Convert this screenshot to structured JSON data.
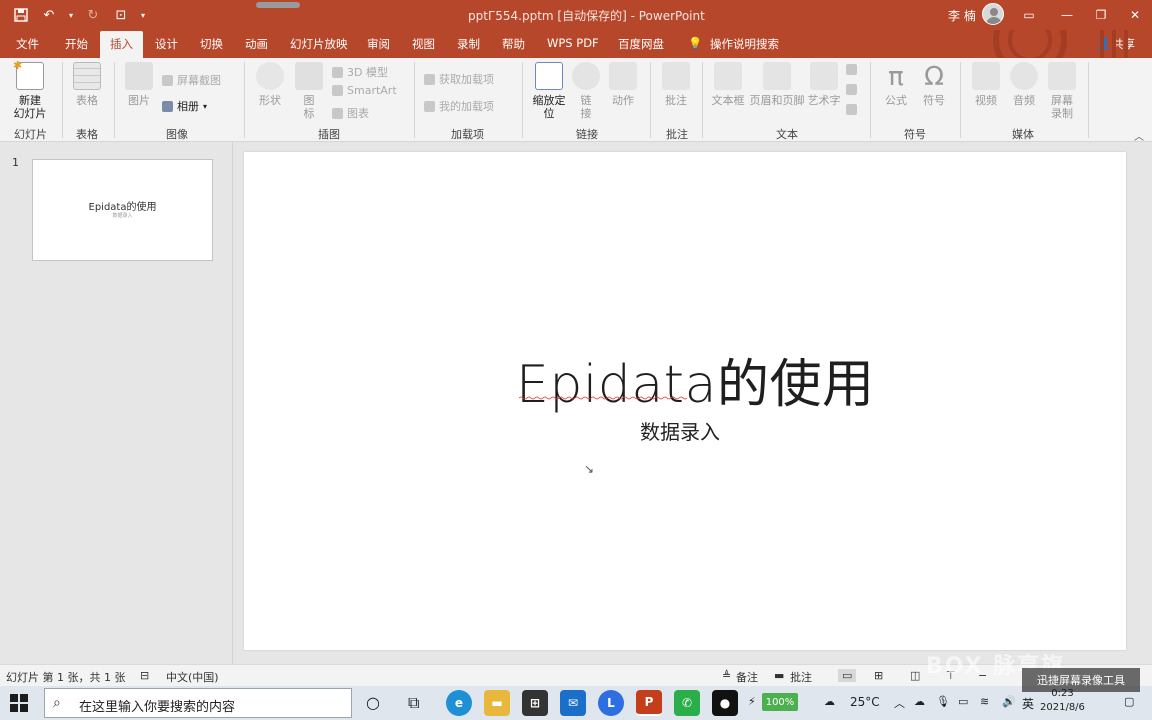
{
  "window": {
    "title": "pptГ554.pptm [自动保存的] - PowerPoint",
    "user": "李 楠"
  },
  "tabs": [
    "文件",
    "开始",
    "插入",
    "设计",
    "切换",
    "动画",
    "幻灯片放映",
    "审阅",
    "视图",
    "录制",
    "帮助",
    "WPS PDF",
    "百度网盘"
  ],
  "active_tab": "插入",
  "tell_me": "操作说明搜索",
  "share": "共享",
  "ribbon": {
    "new_slide": "新建\n幻灯片",
    "table": "表格",
    "picture": "图片",
    "screenshot": "屏幕截图",
    "album": "相册",
    "shapes": "形状",
    "icons": "图\n标",
    "model3d": "3D 模型",
    "smartart": "SmartArt",
    "chart": "图表",
    "get_addins": "获取加载项",
    "my_addins": "我的加载项",
    "zoom": "缩放定\n位",
    "link": "链\n接",
    "action": "动作",
    "comment": "批注",
    "textbox": "文本框",
    "header_footer": "页眉和页脚",
    "wordart": "艺术字",
    "equation": "公式",
    "symbol": "符号",
    "video": "视频",
    "audio": "音频",
    "screen_record": "屏幕\n录制",
    "groups": {
      "slides": "幻灯片",
      "tables": "表格",
      "images": "图像",
      "illustrations": "插图",
      "addins": "加载项",
      "links": "链接",
      "comments": "批注",
      "text": "文本",
      "symbols": "符号",
      "media": "媒体"
    }
  },
  "thumbnails": {
    "number": "1",
    "title": "Epidata的使用",
    "subtitle": "数据录入"
  },
  "slide": {
    "title": "Epidata的使用",
    "subtitle": "数据录入"
  },
  "status": {
    "slide_info": "幻灯片 第 1 张，共 1 张",
    "language": "中文(中国)",
    "notes": "备注",
    "comments": "批注"
  },
  "taskbar": {
    "search_placeholder": "在这里输入你要搜索的内容",
    "battery": "100%",
    "temperature": "25°C",
    "ime": "英",
    "time": "0:23",
    "date": "2021/8/6"
  },
  "watermark": {
    "brand": "BOX 脉享旗",
    "caption": "迅捷屏幕录像工具"
  }
}
